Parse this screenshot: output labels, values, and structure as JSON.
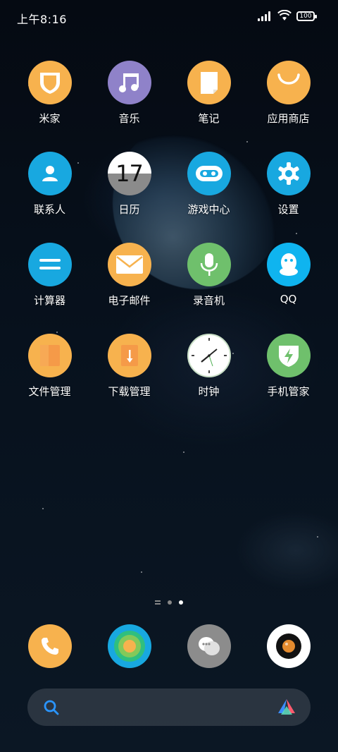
{
  "status": {
    "time": "上午8:16",
    "battery": "100"
  },
  "apps": [
    {
      "label": "米家",
      "icon": "mi-home-icon",
      "color": "#f7b24e"
    },
    {
      "label": "音乐",
      "icon": "music-icon",
      "color": "#8f82c9"
    },
    {
      "label": "笔记",
      "icon": "notes-icon",
      "color": "#f7b24e"
    },
    {
      "label": "应用商店",
      "icon": "app-store-icon",
      "color": "#f7b24e"
    },
    {
      "label": "联系人",
      "icon": "contacts-icon",
      "color": "#18a8e0"
    },
    {
      "label": "日历",
      "icon": "calendar-icon",
      "day": "17"
    },
    {
      "label": "游戏中心",
      "icon": "game-center-icon",
      "color": "#18a8e0"
    },
    {
      "label": "设置",
      "icon": "settings-icon",
      "color": "#18a8e0"
    },
    {
      "label": "计算器",
      "icon": "calculator-icon",
      "color": "#18a8e0"
    },
    {
      "label": "电子邮件",
      "icon": "email-icon",
      "color": "#f7b24e"
    },
    {
      "label": "录音机",
      "icon": "recorder-icon",
      "color": "#6fc06c"
    },
    {
      "label": "QQ",
      "icon": "qq-icon",
      "color": "#0fb4ef"
    },
    {
      "label": "文件管理",
      "icon": "file-manager-icon",
      "color": "#f7b24e"
    },
    {
      "label": "下载管理",
      "icon": "download-manager-icon",
      "color": "#f7b24e"
    },
    {
      "label": "时钟",
      "icon": "clock-icon",
      "color": "#ffffff"
    },
    {
      "label": "手机管家",
      "icon": "security-icon",
      "color": "#6fc06c"
    }
  ],
  "dock": [
    {
      "icon": "phone-icon",
      "color": "#f7b24e"
    },
    {
      "icon": "browser-icon",
      "color": "#18a8e0"
    },
    {
      "icon": "messages-icon",
      "color": "#8c8c8c"
    },
    {
      "icon": "camera-icon",
      "color": "#ffffff"
    }
  ],
  "pages": {
    "count": 2,
    "active": 2
  }
}
